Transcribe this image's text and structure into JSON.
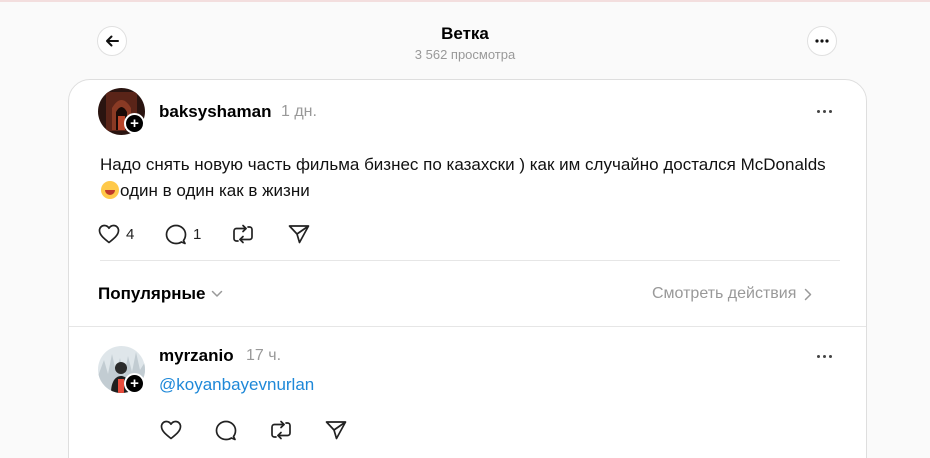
{
  "header": {
    "title": "Ветка",
    "views": "3 562 просмотра"
  },
  "post": {
    "username": "baksyshaman",
    "time": "1 дн.",
    "text_before_emoji": "Надо снять новую часть фильма бизнес по казахски ) как им случайно достался McDonalds",
    "emoji": "laughing-face",
    "text_after_emoji": "один в один как в жизни",
    "likes": "4",
    "replies": "1"
  },
  "sort": {
    "label": "Популярные",
    "activity_label": "Смотреть действия"
  },
  "reply": {
    "username": "myrzanio",
    "time": "17 ч.",
    "text": "@koyanbayevnurlan"
  },
  "colors": {
    "link": "#1e88d8",
    "muted": "#999999",
    "background": "#fafafa"
  }
}
